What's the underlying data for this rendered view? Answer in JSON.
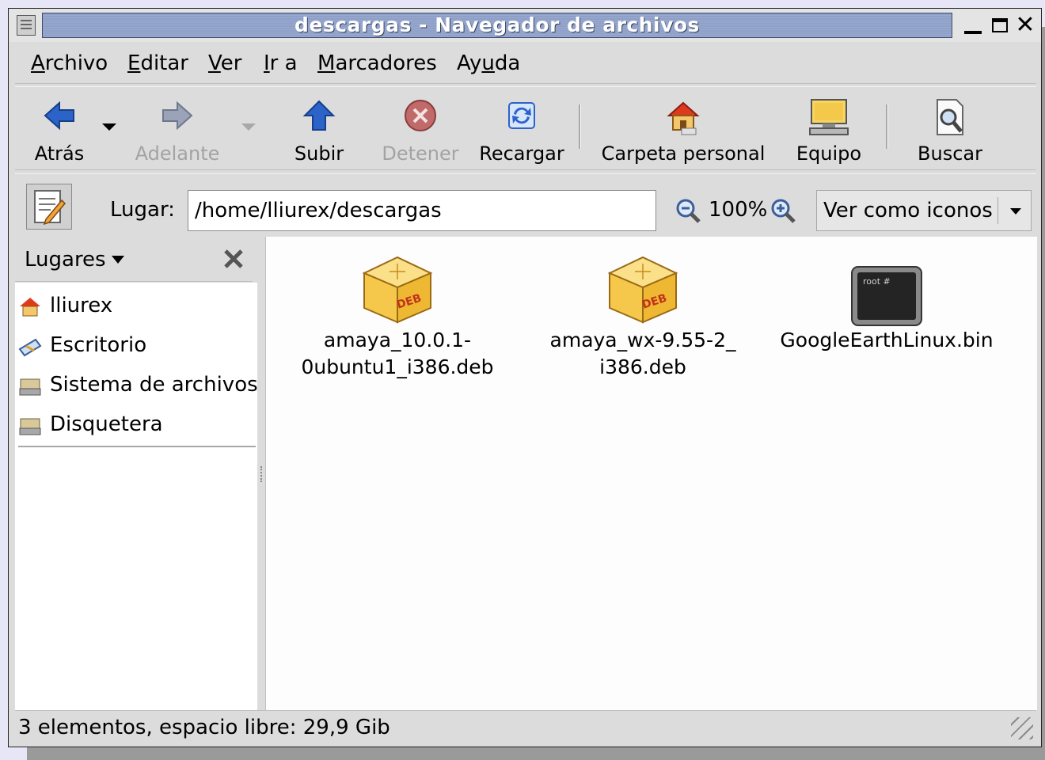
{
  "window": {
    "title": "descargas - Navegador de archivos",
    "close_glyph": "✕"
  },
  "menu": {
    "items": [
      {
        "key": "A",
        "rest": "rchivo"
      },
      {
        "key": "E",
        "rest": "ditar"
      },
      {
        "key": "V",
        "rest": "er"
      },
      {
        "key": "I",
        "rest": "r a"
      },
      {
        "key": "M",
        "rest": "arcadores"
      },
      {
        "pre": "Ay",
        "key": "u",
        "rest": "da"
      }
    ]
  },
  "toolbar": {
    "back": "Atrás",
    "forward": "Adelante",
    "up": "Subir",
    "stop": "Detener",
    "reload": "Recargar",
    "home": "Carpeta personal",
    "computer": "Equipo",
    "search": "Buscar"
  },
  "location": {
    "label": "Lugar:",
    "path": "/home/lliurex/descargas",
    "zoom": "100%",
    "view_mode": "Ver como iconos"
  },
  "sidebar": {
    "title": "Lugares",
    "items": [
      {
        "label": "lliurex",
        "icon": "home-icon"
      },
      {
        "label": "Escritorio",
        "icon": "desktop-icon"
      },
      {
        "label": "Sistema de archivos",
        "icon": "drive-icon"
      },
      {
        "label": "Disquetera",
        "icon": "floppy-icon"
      }
    ]
  },
  "files": [
    {
      "name": "amaya_10.0.1-\n0ubuntu1_i386.deb",
      "icon": "deb-package-icon",
      "badge": "DEB"
    },
    {
      "name": "amaya_wx-9.55-2_\ni386.deb",
      "icon": "deb-package-icon",
      "badge": "DEB"
    },
    {
      "name": "GoogleEarthLinux.bin",
      "icon": "terminal-binary-icon",
      "badge": "root #"
    }
  ],
  "status": {
    "text": "3 elementos, espacio libre: 29,9 Gib"
  },
  "colors": {
    "titlebar": "#8fa0c8",
    "accent_blue": "#2c63c8",
    "deb_box": "#f2c24a"
  }
}
